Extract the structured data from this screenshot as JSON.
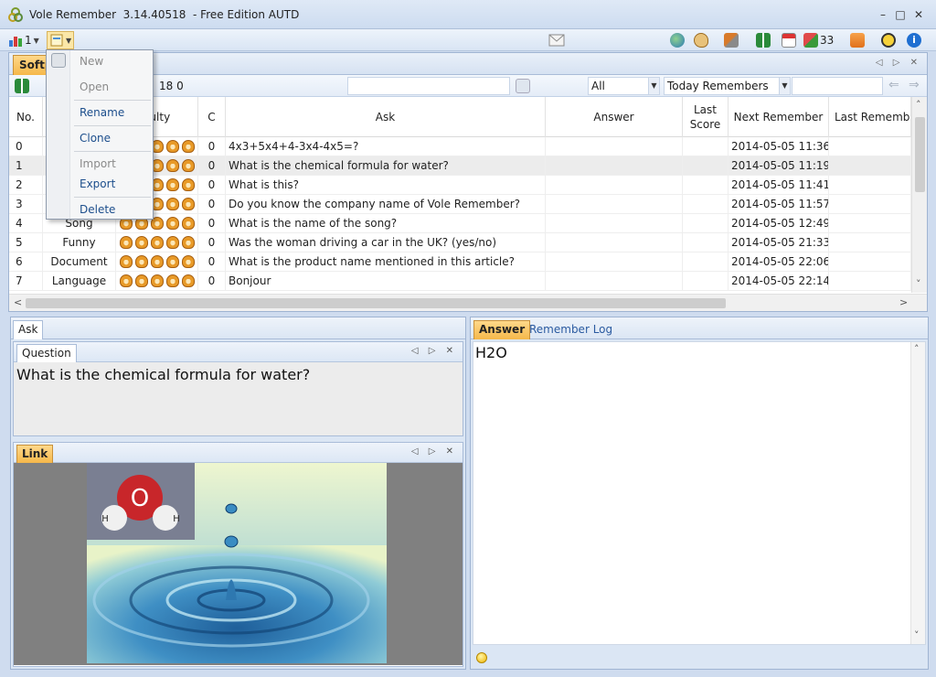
{
  "window": {
    "app_name": "Vole Remember",
    "version": "3.14.40518",
    "edition": "- Free Edition AUTD",
    "minimize": "–",
    "maximize": "□",
    "close": "✕"
  },
  "toolbar": {
    "book_count": "1",
    "today_count": "33"
  },
  "document": {
    "tab_label": "Softp",
    "tab_arrows": "◁ ▷ ✕",
    "counter_text": "18  0",
    "filter_all": "All",
    "filter_mode": "Today Remembers"
  },
  "grid": {
    "headers": {
      "no": "No.",
      "difficulty": "culty",
      "c": "C",
      "ask": "Ask",
      "answer": "Answer",
      "last_score": "Last Score",
      "next_remember": "Next Remember",
      "last_remember": "Last Remembe"
    },
    "rows": [
      {
        "no": "0",
        "category": "",
        "c": "0",
        "ask": "4x3+5x4+4-3x4-4x5=?",
        "next": "2014-05-05 11:36"
      },
      {
        "no": "1",
        "category": "",
        "c": "0",
        "ask": "What is the chemical formula for water?",
        "next": "2014-05-05 11:19"
      },
      {
        "no": "2",
        "category": "",
        "c": "0",
        "ask": "What is this?",
        "next": "2014-05-05 11:41"
      },
      {
        "no": "3",
        "category": "",
        "c": "0",
        "ask": "Do you know the company name of Vole Remember?",
        "next": "2014-05-05 11:57"
      },
      {
        "no": "4",
        "category": "Song",
        "c": "0",
        "ask": "What is the name of the song?",
        "next": "2014-05-05 12:49"
      },
      {
        "no": "5",
        "category": "Funny",
        "c": "0",
        "ask": "Was the woman driving a car in the UK?  (yes/no)",
        "next": "2014-05-05 21:33"
      },
      {
        "no": "6",
        "category": "Document",
        "c": "0",
        "ask": "What is the product name mentioned in this article?",
        "next": "2014-05-05 22:06"
      },
      {
        "no": "7",
        "category": "Language",
        "c": "0",
        "ask": "Bonjour",
        "next": "2014-05-05 22:14"
      }
    ]
  },
  "context_menu": {
    "new": "New",
    "open": "Open",
    "rename": "Rename",
    "clone": "Clone",
    "import": "Import",
    "export": "Export",
    "delete": "Delete"
  },
  "ask_panel": {
    "tab": "Ask",
    "question_tab": "Question",
    "question_text": "What is the chemical formula for water?",
    "link_tab": "Link",
    "molecule_o": "O",
    "molecule_h1": "H",
    "molecule_h2": "H"
  },
  "answer_panel": {
    "tab_answer": "Answer",
    "tab_log": "Remember Log",
    "answer_text": "H2O"
  },
  "colors": {
    "accent_tab": "#f5b84a",
    "link_blue": "#1c4e8c",
    "selected_row": "#ececec"
  }
}
